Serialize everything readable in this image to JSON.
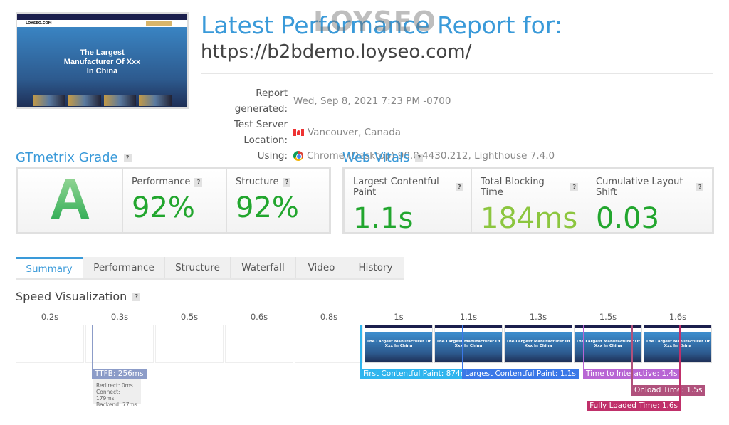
{
  "header": {
    "title": "Latest Performance Report for:",
    "url": "https://b2bdemo.loyseo.com/",
    "watermark": "LOYSEO"
  },
  "thumbnail": {
    "logo": "LOYSEO.COM",
    "headline_1": "The Largest",
    "headline_2": "Manufacturer Of Xxx",
    "headline_3": "In China"
  },
  "info": [
    {
      "label": "Report generated:",
      "value": "Wed, Sep 8, 2021 7:23 PM -0700"
    },
    {
      "label": "Test Server Location:",
      "value": "Vancouver, Canada",
      "icon": "canada-flag-icon"
    },
    {
      "label": "Using:",
      "value": "Chrome (Desktop) 90.0.4430.212, Lighthouse 7.4.0",
      "icon": "chrome-icon"
    }
  ],
  "grade": {
    "heading": "GTmetrix Grade",
    "letter": "A",
    "performance_label": "Performance",
    "performance": "92%",
    "structure_label": "Structure",
    "structure": "92%",
    "color": "#22a62e"
  },
  "vitals": {
    "heading": "Web Vitals",
    "items": [
      {
        "label": "Largest Contentful Paint",
        "value": "1.1s",
        "color": "#22a62e"
      },
      {
        "label": "Total Blocking Time",
        "value": "184ms",
        "color": "#8cc63f"
      },
      {
        "label": "Cumulative Layout Shift",
        "value": "0.03",
        "color": "#22a62e"
      }
    ]
  },
  "help": "?",
  "tabs": [
    "Summary",
    "Performance",
    "Structure",
    "Waterfall",
    "Video",
    "History"
  ],
  "speed": {
    "heading": "Speed Visualization",
    "frames": [
      "0.2s",
      "0.3s",
      "0.5s",
      "0.6s",
      "0.8s",
      "1s",
      "1.1s",
      "1.3s",
      "1.5s",
      "1.6s"
    ],
    "frame_text": "The Largest Manufacturer Of Xxx In China",
    "ttfb": "TTFB: 256ms",
    "ttfb_details": [
      "Redirect: 0ms",
      "Connect: 179ms",
      "Backend: 77ms"
    ],
    "markers": {
      "fcp": "First Contentful Paint: 874ms",
      "lcp": "Largest Contentful Paint: 1.1s",
      "tti": "Time to Interactive: 1.4s",
      "onload": "Onload Time: 1.5s",
      "fully": "Fully Loaded Time: 1.6s"
    },
    "colors": {
      "ttfb": "#8c9cc8",
      "fcp": "#2fb5ee",
      "lcp": "#3b78e7",
      "tti": "#b865d4",
      "onload": "#b0517c",
      "fully": "#c0306a"
    }
  }
}
